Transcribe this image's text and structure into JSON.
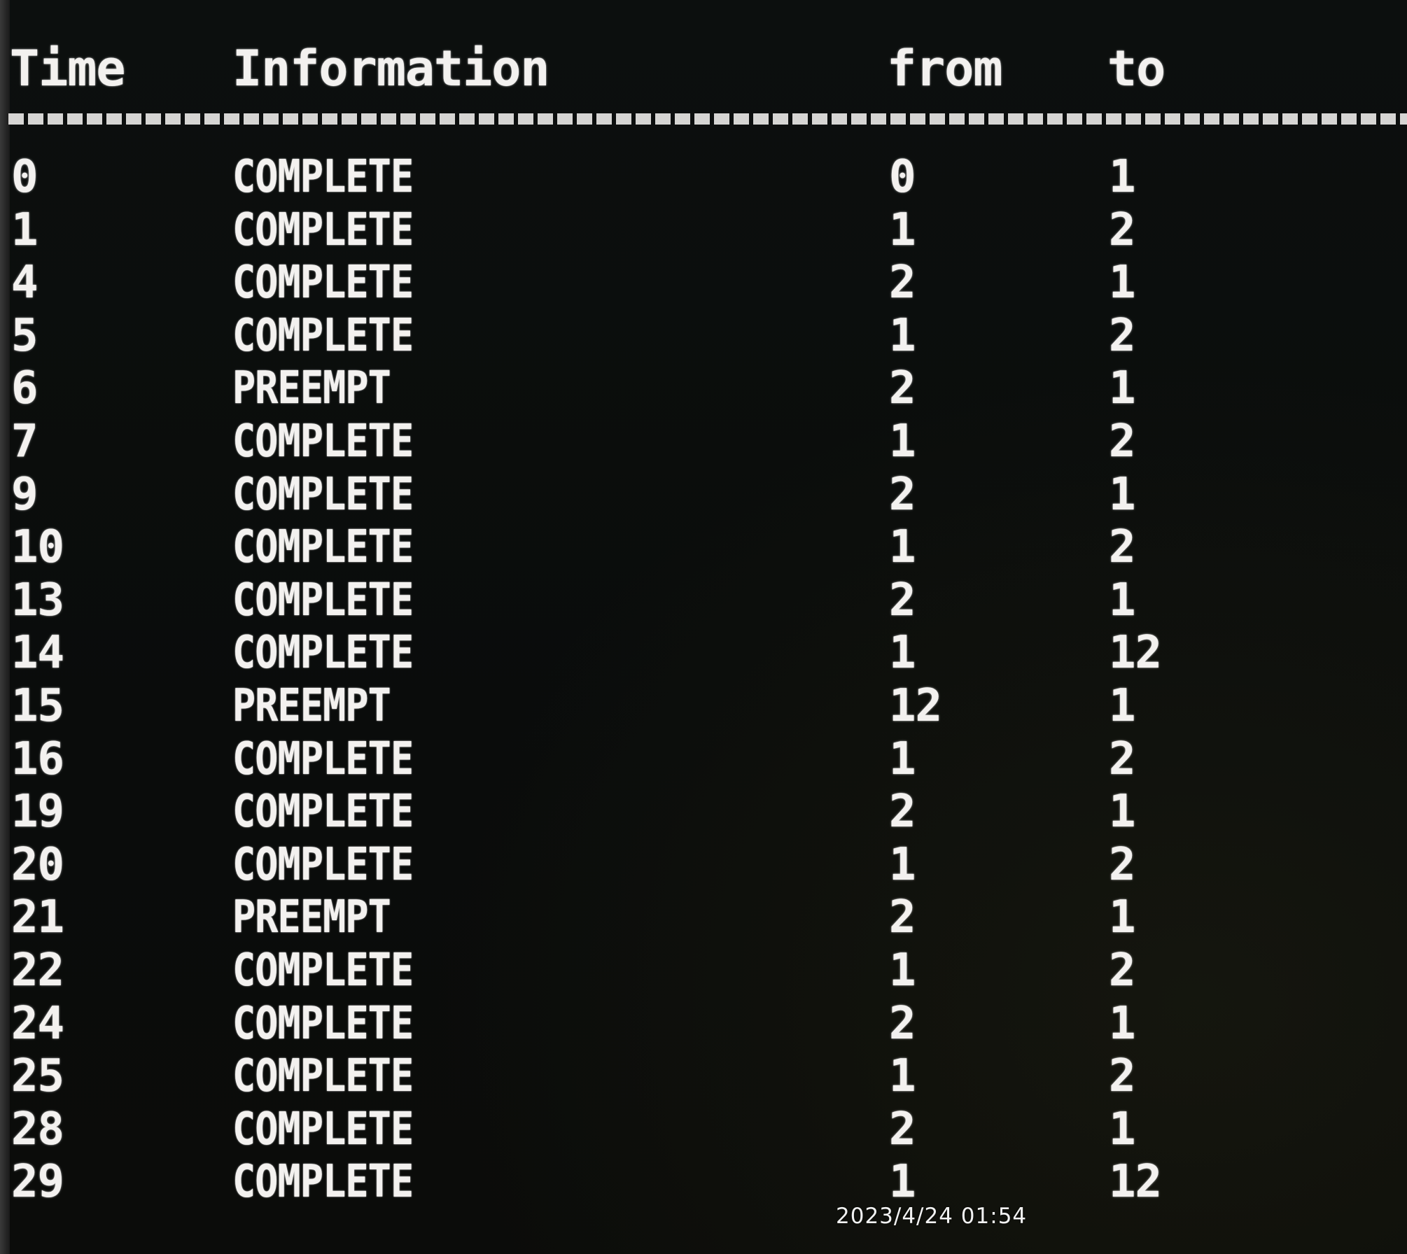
{
  "header": {
    "time": "Time",
    "information": "Information",
    "from": "from",
    "to": "to"
  },
  "rows": [
    {
      "time": "0",
      "info": "COMPLETE",
      "from": "0",
      "to": "1"
    },
    {
      "time": "1",
      "info": "COMPLETE",
      "from": "1",
      "to": "2"
    },
    {
      "time": "4",
      "info": "COMPLETE",
      "from": "2",
      "to": "1"
    },
    {
      "time": "5",
      "info": "COMPLETE",
      "from": "1",
      "to": "2"
    },
    {
      "time": "6",
      "info": "PREEMPT",
      "from": "2",
      "to": "1"
    },
    {
      "time": "7",
      "info": "COMPLETE",
      "from": "1",
      "to": "2"
    },
    {
      "time": "9",
      "info": "COMPLETE",
      "from": "2",
      "to": "1"
    },
    {
      "time": "10",
      "info": "COMPLETE",
      "from": "1",
      "to": "2"
    },
    {
      "time": "13",
      "info": "COMPLETE",
      "from": "2",
      "to": "1"
    },
    {
      "time": "14",
      "info": "COMPLETE",
      "from": "1",
      "to": "12"
    },
    {
      "time": "15",
      "info": "PREEMPT",
      "from": "12",
      "to": "1"
    },
    {
      "time": "16",
      "info": "COMPLETE",
      "from": "1",
      "to": "2"
    },
    {
      "time": "19",
      "info": "COMPLETE",
      "from": "2",
      "to": "1"
    },
    {
      "time": "20",
      "info": "COMPLETE",
      "from": "1",
      "to": "2"
    },
    {
      "time": "21",
      "info": "PREEMPT",
      "from": "2",
      "to": "1"
    },
    {
      "time": "22",
      "info": "COMPLETE",
      "from": "1",
      "to": "2"
    },
    {
      "time": "24",
      "info": "COMPLETE",
      "from": "2",
      "to": "1"
    },
    {
      "time": "25",
      "info": "COMPLETE",
      "from": "1",
      "to": "2"
    },
    {
      "time": "28",
      "info": "COMPLETE",
      "from": "2",
      "to": "1"
    },
    {
      "time": "29",
      "info": "COMPLETE",
      "from": "1",
      "to": "12"
    }
  ],
  "photo_timestamp": "2023/4/24 01:54"
}
